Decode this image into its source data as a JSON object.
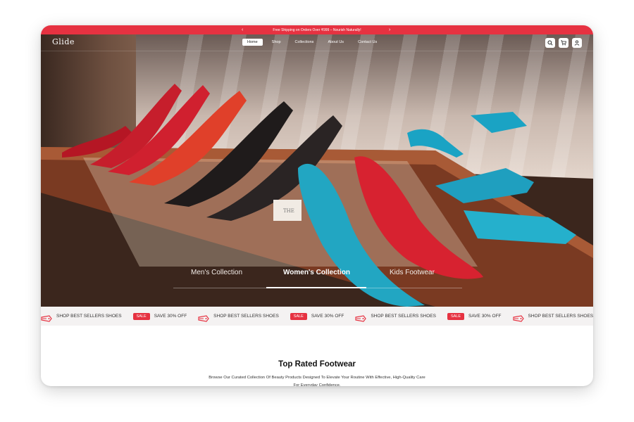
{
  "announcement": {
    "text": "Free Shipping on Orders Over ₹999 – Nourish Naturally!",
    "prev": "‹",
    "next": "›"
  },
  "brand": {
    "logo": "Glide"
  },
  "nav": {
    "items": [
      "Home",
      "Shop",
      "Collections",
      "About Us",
      "Contact Us"
    ],
    "active": "Home"
  },
  "header_icons": [
    "search-icon",
    "cart-icon",
    "user-icon"
  ],
  "hero": {
    "tabs": [
      "Men's Collection",
      "Women's Collection",
      "Kids Footwear"
    ],
    "active_tab": "Women's Collection",
    "shelf_sign": "THE"
  },
  "marquee": {
    "promo": "SHOP BEST SELLERS SHOES",
    "sale_badge": "SALE",
    "sale_text": "SAVE 30% OFF"
  },
  "section": {
    "title": "Top Rated Footwear",
    "subtitle": "Browse Our Curated Collection Of Beauty Products Designed To Elevate Your Routine With Effective, High-Quality Care For Everyday Confidence."
  },
  "colors": {
    "accent": "#e63241",
    "marquee_bg": "#f4f2f2"
  }
}
